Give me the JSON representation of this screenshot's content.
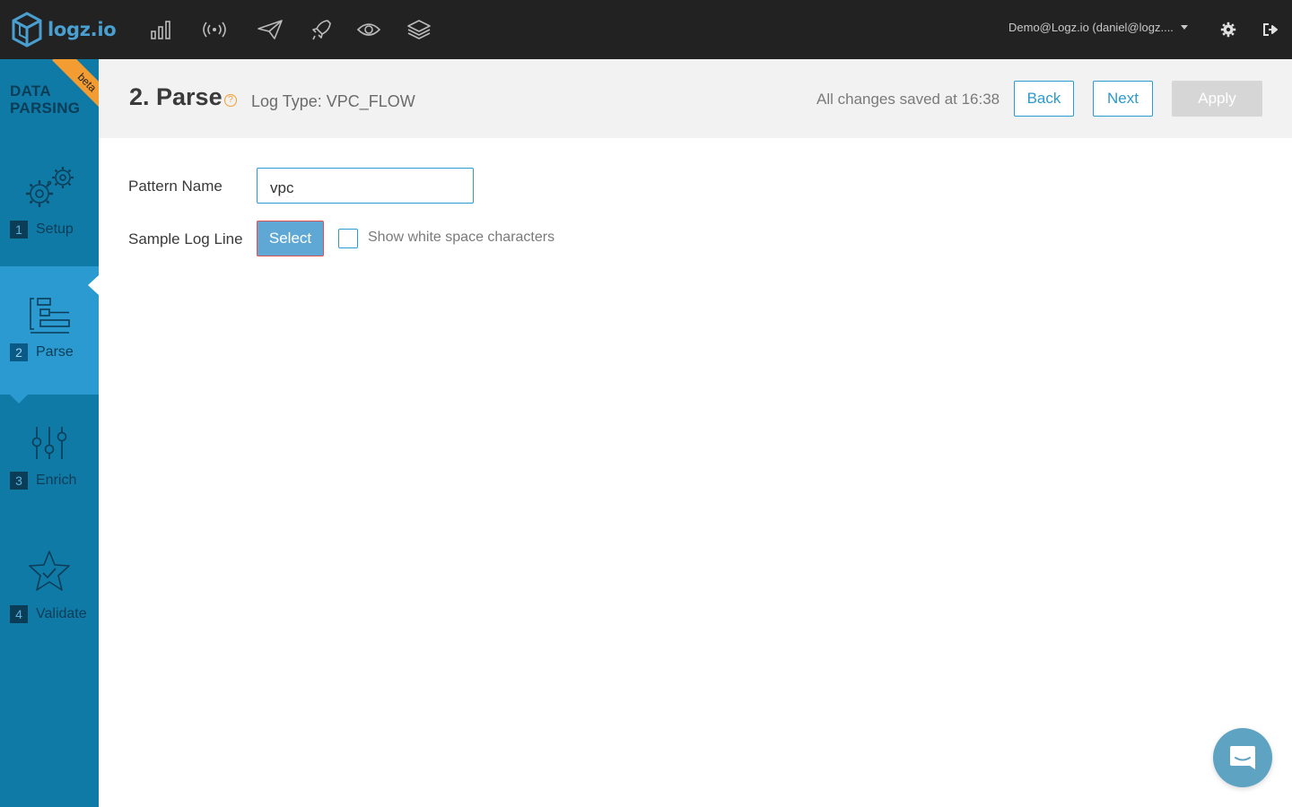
{
  "brand": {
    "name": "logz.io"
  },
  "nav_icons": [
    "bar-chart-icon",
    "live-tail-icon",
    "send-icon",
    "rocket-icon",
    "eye-icon",
    "layers-icon"
  ],
  "account": {
    "label": "Demo@Logz.io (daniel@logz...."
  },
  "sidebar": {
    "title_line1": "DATA",
    "title_line2": "PARSING",
    "badge": "beta",
    "steps": [
      {
        "num": "1",
        "name": "Setup",
        "active": false
      },
      {
        "num": "2",
        "name": "Parse",
        "active": true
      },
      {
        "num": "3",
        "name": "Enrich",
        "active": false
      },
      {
        "num": "4",
        "name": "Validate",
        "active": false
      }
    ]
  },
  "header": {
    "title": "2. Parse",
    "help": "?",
    "log_type": "Log Type: VPC_FLOW",
    "saved_status": "All changes saved at 16:38",
    "back_label": "Back",
    "next_label": "Next",
    "apply_label": "Apply"
  },
  "form": {
    "pattern_name_label": "Pattern Name",
    "pattern_name_value": "vpc",
    "sample_log_label": "Sample Log Line",
    "select_label": "Select",
    "whitespace_label": "Show white space characters",
    "whitespace_checked": false
  },
  "colors": {
    "topbar": "#222222",
    "sidebar": "#107aa6",
    "sidebar_active": "#2b9ad0",
    "accent": "#2b9ad0",
    "beta": "#f39c32"
  }
}
